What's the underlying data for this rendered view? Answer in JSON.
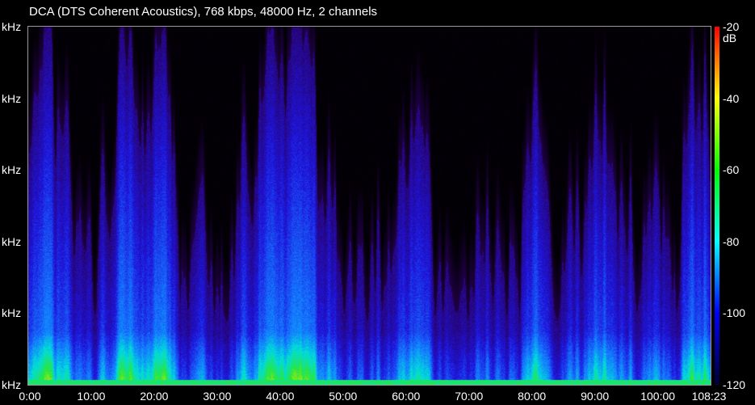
{
  "header": {
    "title": "DCA (DTS Coherent Acoustics), 768 kbps, 48000 Hz, 2 channels"
  },
  "colors": {
    "background": "#000000",
    "scale_stops": [
      "#ff0000",
      "#ffff00",
      "#00ff00",
      "#00ffff",
      "#0000ff",
      "#000030"
    ]
  },
  "chart_data": {
    "type": "heatmap",
    "title": "DCA (DTS Coherent Acoustics), 768 kbps, 48000 Hz, 2 channels",
    "x_ticks": [
      "0:00",
      "10:00",
      "20:00",
      "30:00",
      "40:00",
      "50:00",
      "60:00",
      "70:00",
      "80:00",
      "90:00",
      "100:00",
      "108:23"
    ],
    "x_tick_minutes": [
      0,
      10,
      20,
      30,
      40,
      50,
      60,
      70,
      80,
      90,
      100,
      108.383
    ],
    "x_range_minutes": [
      0,
      108.383
    ],
    "y_ticks": [
      "kHz",
      "kHz",
      "kHz",
      "kHz",
      "kHz",
      "kHz"
    ],
    "y_tick_fraction": [
      1.0,
      0.8,
      0.6,
      0.4,
      0.2,
      0.0
    ],
    "colorbar_ticks": [
      "-20 dB",
      "-40",
      "-60",
      "-80",
      "-100",
      "-120"
    ],
    "colorbar_values": [
      -20,
      -40,
      -60,
      -80,
      -100,
      -120
    ],
    "colorbar_range": [
      -120,
      -20
    ],
    "grid": false
  }
}
